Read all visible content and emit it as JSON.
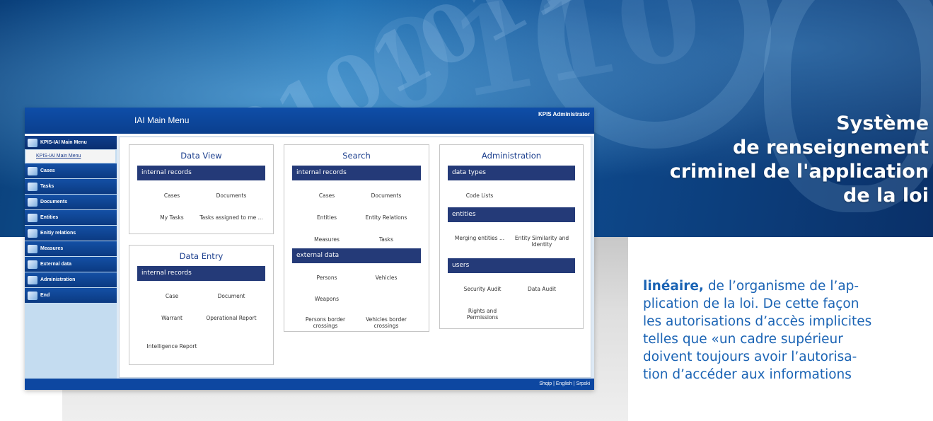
{
  "banner": {
    "title_lines": [
      "Système",
      "de renseignement",
      "criminel de l'application",
      "de la loi"
    ]
  },
  "app": {
    "title": "IAI Main Menu",
    "user": "KPIS Administrator",
    "sidebar": {
      "head": "KPIS-IAI Main Menu",
      "sub": "KPIS-IAI Main Menu",
      "items": [
        {
          "label": "Cases",
          "icon": "cases-icon"
        },
        {
          "label": "Tasks",
          "icon": "tasks-icon"
        },
        {
          "label": "Documents",
          "icon": "documents-icon"
        },
        {
          "label": "Entities",
          "icon": "entities-icon"
        },
        {
          "label": "Enitiy relations",
          "icon": "entity-relations-icon"
        },
        {
          "label": "Measures",
          "icon": "measures-icon"
        },
        {
          "label": "External data",
          "icon": "external-data-icon"
        },
        {
          "label": "Administration",
          "icon": "administration-icon"
        },
        {
          "label": "End",
          "icon": "end-icon"
        }
      ]
    },
    "panels": {
      "data_view": {
        "title": "Data View",
        "bar": "internal records",
        "links": [
          "Cases",
          "Documents",
          "My Tasks",
          "Tasks assigned to me ..."
        ]
      },
      "data_entry": {
        "title": "Data Entry",
        "bar": "internal records",
        "links": [
          "Case",
          "Document",
          "Warrant",
          "Operational Report",
          "Intelligence Report"
        ]
      },
      "search": {
        "title": "Search",
        "bar1": "internal records",
        "links1": [
          "Cases",
          "Documents",
          "Entities",
          "Entity Relations",
          "Measures",
          "Tasks"
        ],
        "bar2": "external data",
        "links2": [
          "Persons",
          "Vehicles",
          "Weapons",
          "Persons border crossings",
          "Vehicles border crossings"
        ]
      },
      "administration": {
        "title": "Administration",
        "bar1": "data types",
        "links1": [
          "Code Lists"
        ],
        "bar2": "entities",
        "links2": [
          "Merging entities ...",
          "Entity Similarity and Identity"
        ],
        "bar3": "users",
        "links3": [
          "Security Audit",
          "Data Audit",
          "Rights and Permissions"
        ]
      }
    },
    "footer": {
      "langs": [
        "Shqip",
        "English",
        "Srpski"
      ],
      "separator": " | "
    }
  },
  "body_text": {
    "bold_lead": "linéaire,",
    "line1_rest": " de l’organisme de l’ap-",
    "line2": "plication de la loi. De cette façon",
    "line3": "les autorisations d’accès implicites",
    "line4": "telles que «un cadre supérieur",
    "line5": "doivent toujours avoir l’autorisa-",
    "line6": "tion d’accéder aux informations"
  }
}
